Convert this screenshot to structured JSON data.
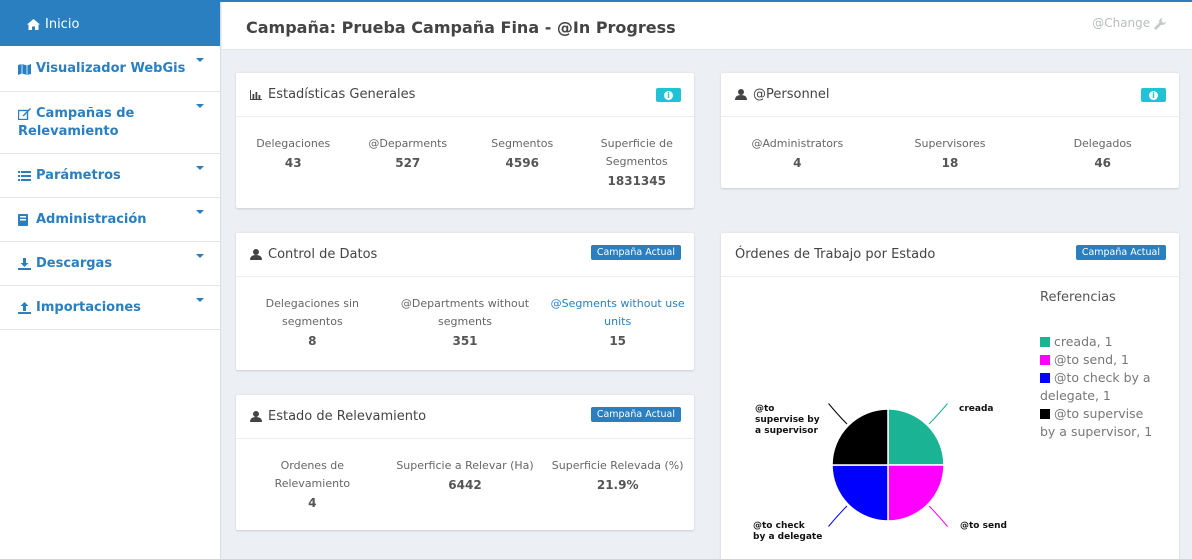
{
  "sidebar": {
    "items": [
      {
        "label": "Inicio",
        "icon": "home-icon"
      },
      {
        "label": "Visualizador WebGis",
        "icon": "map-icon"
      },
      {
        "label": "Campañas de",
        "label2": "Relevamiento",
        "icon": "edit-icon"
      },
      {
        "label": "Parámetros",
        "icon": "list-icon"
      },
      {
        "label": "Administración",
        "icon": "book-icon"
      },
      {
        "label": "Descargas",
        "icon": "download-icon"
      },
      {
        "label": "Importaciones",
        "icon": "upload-icon"
      }
    ]
  },
  "header": {
    "title": "Campaña: Prueba Campaña Fina - @In Progress",
    "change": "@Change"
  },
  "estadisticas": {
    "title": "Estadísticas Generales",
    "stats": [
      {
        "label": "Delegaciones",
        "value": "43"
      },
      {
        "label": "@Deparments",
        "value": "527"
      },
      {
        "label": "Segmentos",
        "value": "4596"
      },
      {
        "label": "Superficie de",
        "label2": "Segmentos",
        "value": "1831345"
      }
    ]
  },
  "personnel": {
    "title": "@Personnel",
    "stats": [
      {
        "label": "@Administrators",
        "value": "4"
      },
      {
        "label": "Supervisores",
        "value": "18"
      },
      {
        "label": "Delegados",
        "value": "46"
      }
    ]
  },
  "control": {
    "title": "Control de Datos",
    "badge": "Campaña Actual",
    "stats": [
      {
        "label": "Delegaciones sin",
        "label2": "segmentos",
        "value": "8"
      },
      {
        "label": "@Departments without",
        "label2": "segments",
        "value": "351"
      },
      {
        "label": "@Segments without use",
        "label2": "units",
        "value": "15"
      }
    ]
  },
  "estado": {
    "title": "Estado de Relevamiento",
    "badge": "Campaña Actual",
    "stats": [
      {
        "label": "Ordenes de",
        "label2": "Relevamiento",
        "value": "4"
      },
      {
        "label": "Superficie a Relevar (Ha)",
        "value": "6442"
      },
      {
        "label": "Superficie Relevada (%)",
        "value": "21.9%"
      }
    ]
  },
  "ordenes": {
    "title": "Órdenes de Trabajo por Estado",
    "badge": "Campaña Actual",
    "legend_title": "Referencias",
    "legend": [
      {
        "text": "creada, 1",
        "color": "#1ab394"
      },
      {
        "text": "@to send, 1",
        "color": "#ff00ff"
      },
      {
        "text": "@to check by a delegate, 1",
        "color": "#0000ff"
      },
      {
        "text": "@to supervise by a supervisor, 1",
        "color": "#000000"
      }
    ]
  },
  "chart_data": {
    "type": "pie",
    "categories": [
      "creada",
      "@to send",
      "@to check by a delegate",
      "@to supervise by a supervisor"
    ],
    "values": [
      1,
      1,
      1,
      1
    ],
    "colors": [
      "#1ab394",
      "#ff00ff",
      "#0000ff",
      "#000000"
    ],
    "labels": {
      "creada": "creada",
      "to_send": "@to send",
      "to_check_1": "@to check",
      "to_check_2": "by a delegate",
      "to_supervise_1": "@to",
      "to_supervise_2": "supervise by",
      "to_supervise_3": "a supervisor"
    }
  }
}
